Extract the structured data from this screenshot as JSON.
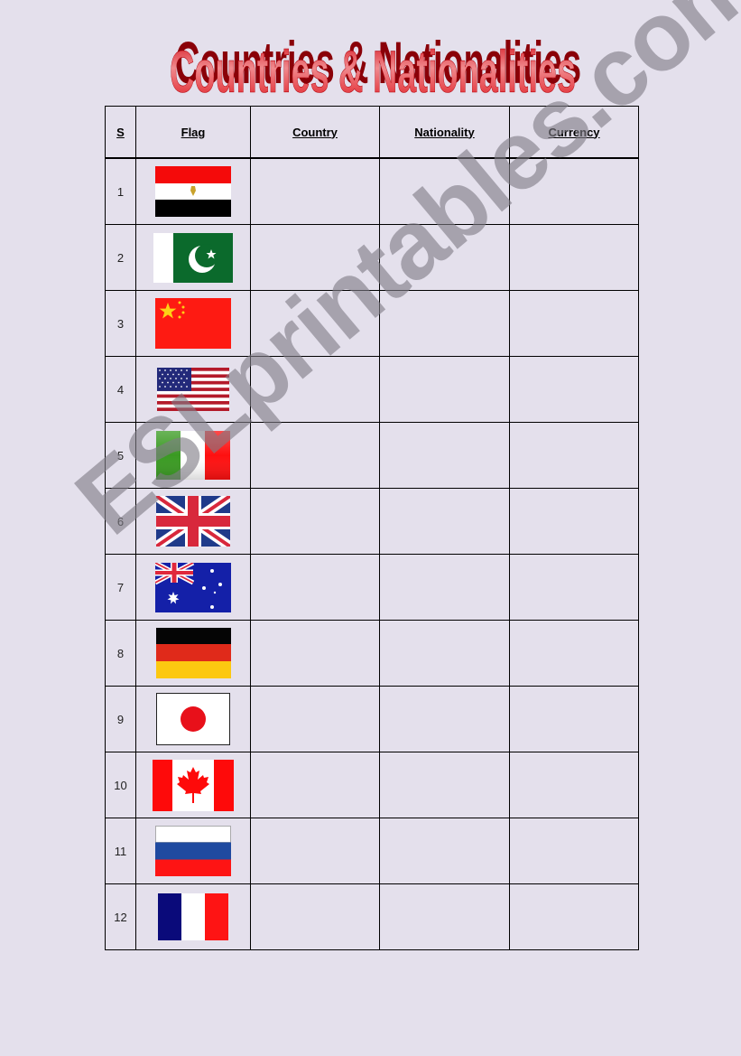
{
  "title": "Countries & Nationalities",
  "table": {
    "headers": {
      "s": "S",
      "flag": "Flag",
      "country": "Country",
      "nationality": "Nationality",
      "currency": "Currency"
    },
    "rows": [
      {
        "n": "1",
        "flag": "egypt-flag-icon",
        "country": "",
        "nationality": "",
        "currency": ""
      },
      {
        "n": "2",
        "flag": "pakistan-flag-icon",
        "country": "",
        "nationality": "",
        "currency": ""
      },
      {
        "n": "3",
        "flag": "china-flag-icon",
        "country": "",
        "nationality": "",
        "currency": ""
      },
      {
        "n": "4",
        "flag": "usa-flag-icon",
        "country": "",
        "nationality": "",
        "currency": ""
      },
      {
        "n": "5",
        "flag": "italy-flag-icon",
        "country": "",
        "nationality": "",
        "currency": ""
      },
      {
        "n": "6",
        "flag": "uk-flag-icon",
        "country": "",
        "nationality": "",
        "currency": ""
      },
      {
        "n": "7",
        "flag": "australia-flag-icon",
        "country": "",
        "nationality": "",
        "currency": ""
      },
      {
        "n": "8",
        "flag": "germany-flag-icon",
        "country": "",
        "nationality": "",
        "currency": ""
      },
      {
        "n": "9",
        "flag": "japan-flag-icon",
        "country": "",
        "nationality": "",
        "currency": ""
      },
      {
        "n": "10",
        "flag": "canada-flag-icon",
        "country": "",
        "nationality": "",
        "currency": ""
      },
      {
        "n": "11",
        "flag": "russia-flag-icon",
        "country": "",
        "nationality": "",
        "currency": ""
      },
      {
        "n": "12",
        "flag": "france-flag-icon",
        "country": "",
        "nationality": "",
        "currency": ""
      }
    ]
  },
  "watermark": "ESLprintables.com",
  "colors": {
    "background": "#e4e0ec",
    "title_red": "#e0101a",
    "watermark_gray": "#8a8690"
  }
}
